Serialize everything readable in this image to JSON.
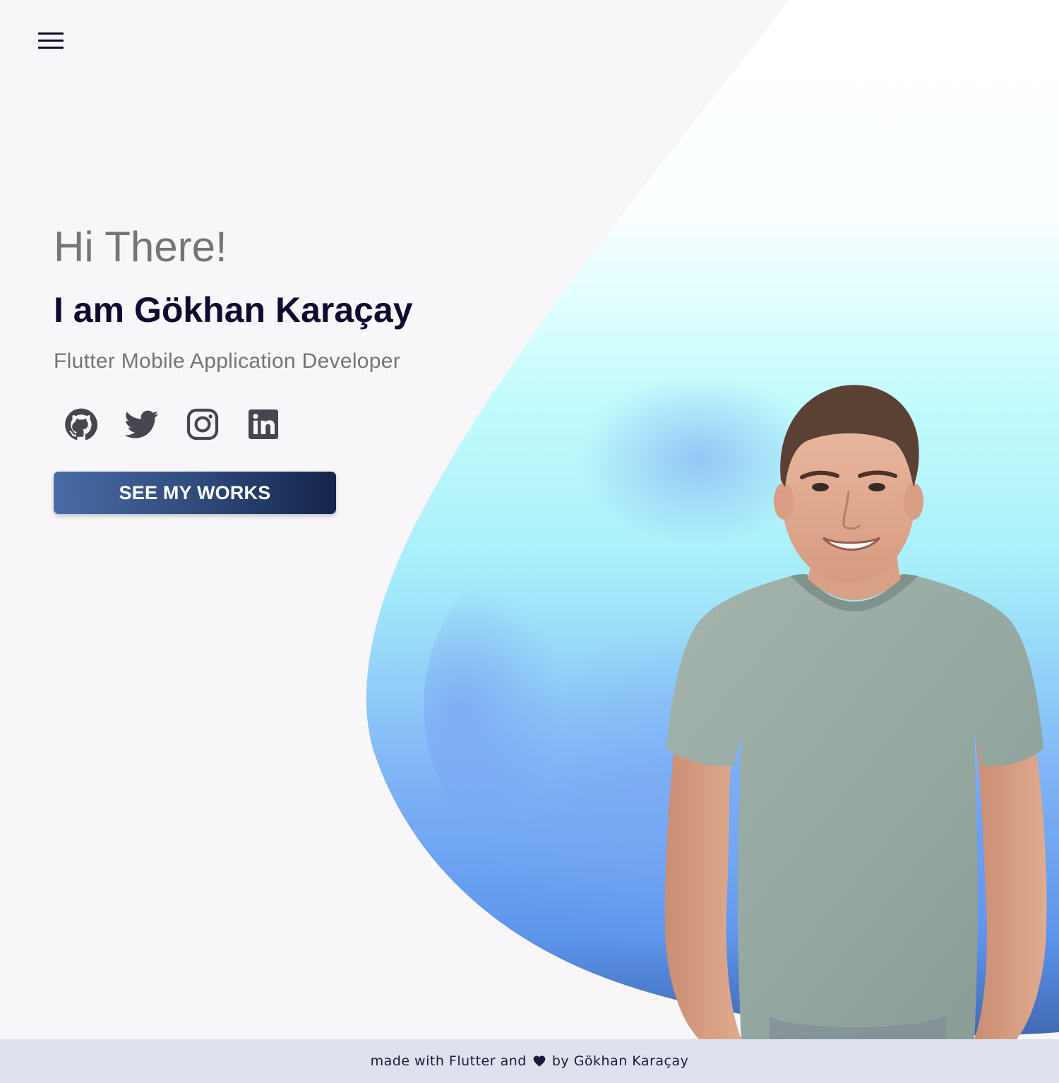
{
  "menu": {
    "icon": "hamburger-menu-icon"
  },
  "hero": {
    "greeting": "Hi There!",
    "name": "I am Gökhan Karaçay",
    "role": "Flutter Mobile Application Developer",
    "cta_label": "SEE MY WORKS"
  },
  "socials": [
    {
      "icon": "github-icon"
    },
    {
      "icon": "twitter-icon"
    },
    {
      "icon": "instagram-icon"
    },
    {
      "icon": "linkedin-icon"
    }
  ],
  "footer": {
    "prefix": "made with Flutter and",
    "heart_icon": "heart-icon",
    "suffix": "by Gökhan Karaçay"
  },
  "colors": {
    "page_background": "#f8f6f8",
    "title_dark": "#0d0b2e",
    "text_grey": "#757575",
    "icon_grey": "#48454e",
    "button_gradient_start": "#4a6ca5",
    "button_gradient_end": "#14244a",
    "footer_background": "#dde2ee",
    "blob_cyan": "#b9fbfb",
    "blob_blue": "#5d99f3"
  }
}
